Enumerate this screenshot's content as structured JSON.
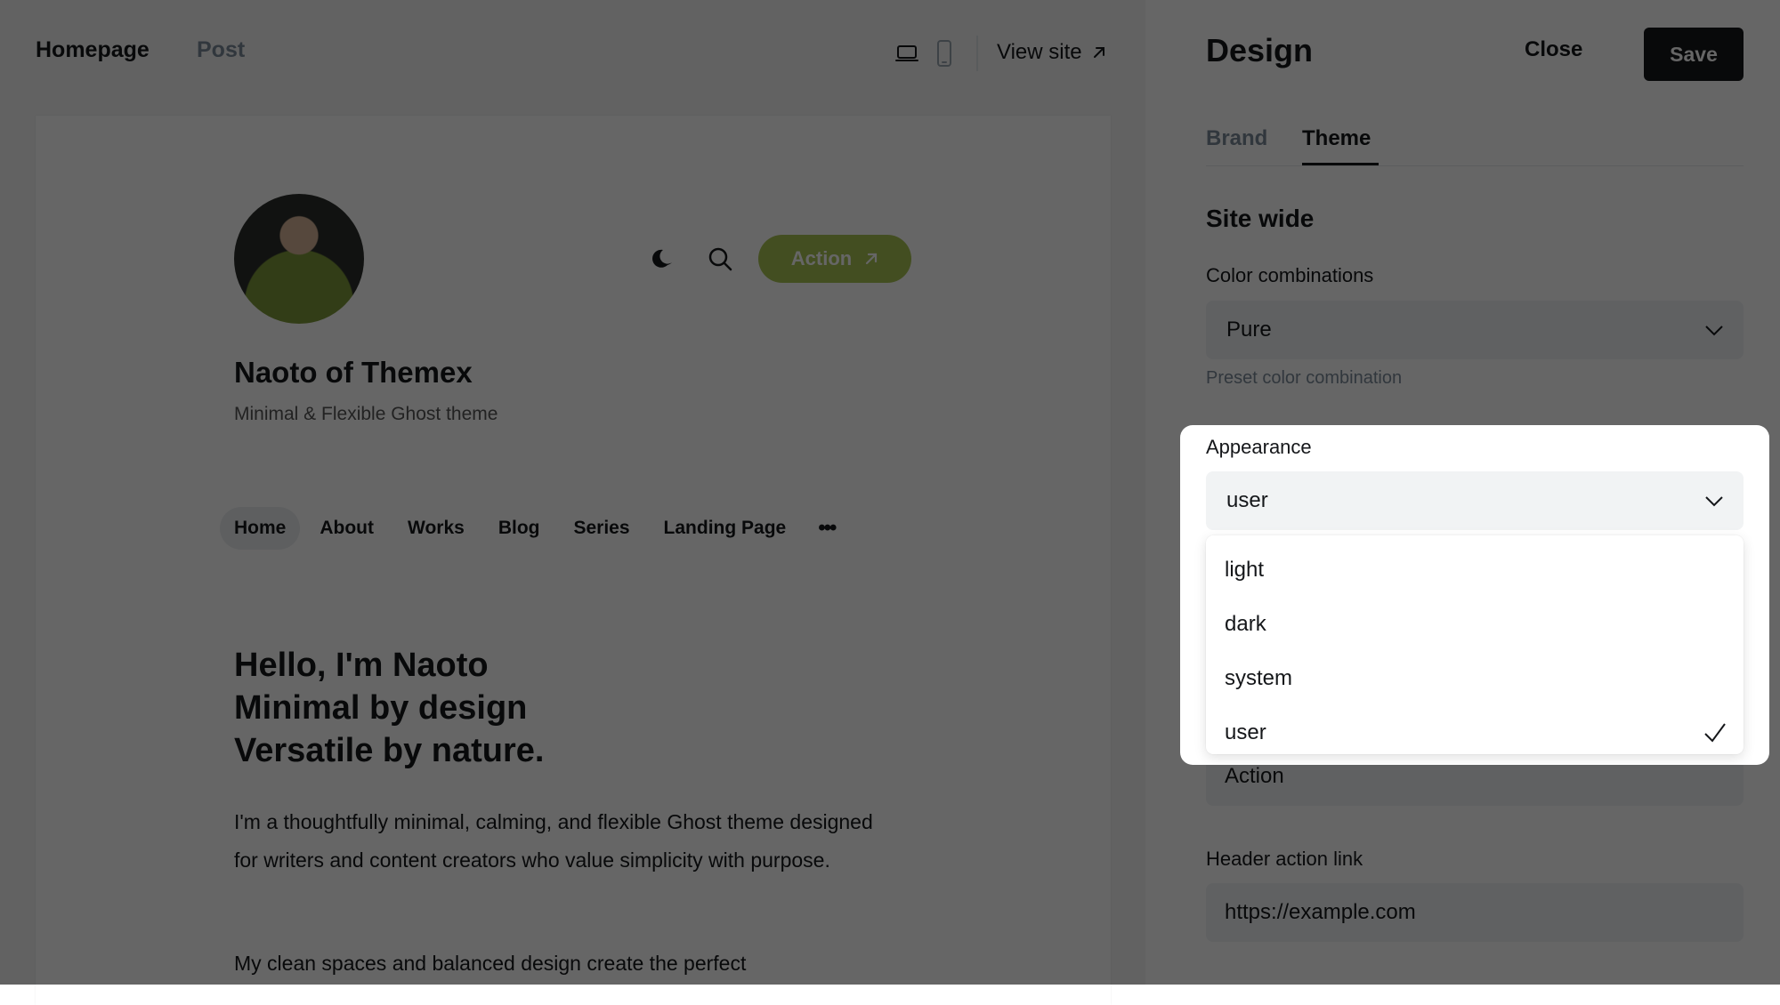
{
  "preview": {
    "tabs": [
      "Homepage",
      "Post"
    ],
    "view_site_label": "View site",
    "action_label": "Action",
    "site_title": "Naoto of Themex",
    "site_description": "Minimal & Flexible Ghost theme",
    "nav_items": [
      "Home",
      "About",
      "Works",
      "Blog",
      "Series",
      "Landing Page"
    ],
    "nav_more": "•••",
    "hero_lines": [
      "Hello, I'm Naoto",
      "Minimal by design",
      "Versatile by nature."
    ],
    "paragraph1": "I'm a thoughtfully minimal, calming, and flexible Ghost theme designed for writers and content creators who value simplicity with purpose.",
    "paragraph2": "My clean spaces and balanced design create the perfect"
  },
  "panel": {
    "title": "Design",
    "close_label": "Close",
    "save_label": "Save",
    "tabs": [
      "Brand",
      "Theme"
    ],
    "active_tab": "Theme",
    "section_title": "Site wide",
    "color_combinations_label": "Color combinations",
    "color_combinations_value": "Pure",
    "color_combinations_hint": "Preset color combination",
    "appearance_label": "Appearance",
    "appearance_value": "user",
    "appearance_options": [
      "light",
      "dark",
      "system",
      "user"
    ],
    "appearance_selected": "user",
    "header_action_text_value": "Action",
    "header_action_link_label": "Header action link",
    "header_action_link_value": "https://example.com"
  },
  "colors": {
    "accent": "#a9c354",
    "primary_button": "#15171a",
    "overlay": "rgba(0,0,0,0.6)"
  },
  "icons": [
    "laptop-icon",
    "mobile-icon",
    "external-arrow-icon",
    "moon-icon",
    "search-icon",
    "chevron-down-icon",
    "check-icon"
  ]
}
